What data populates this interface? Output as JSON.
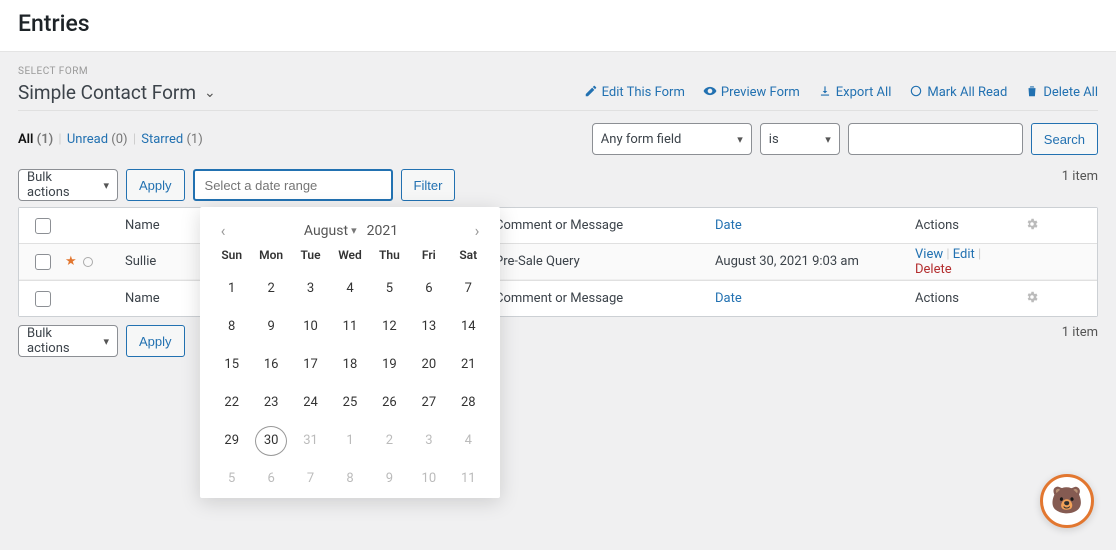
{
  "page": {
    "title": "Entries"
  },
  "select_form_label": "SELECT FORM",
  "form": {
    "name": "Simple Contact Form"
  },
  "form_actions": {
    "edit": "Edit This Form",
    "preview": "Preview Form",
    "export": "Export All",
    "mark_read": "Mark All Read",
    "delete_all": "Delete All"
  },
  "status_tabs": {
    "all_label": "All",
    "all_count": "(1)",
    "unread_label": "Unread",
    "unread_count": "(0)",
    "starred_label": "Starred",
    "starred_count": "(1)"
  },
  "search": {
    "field": "Any form field",
    "op": "is",
    "value": "",
    "button": "Search"
  },
  "bulk": {
    "label": "Bulk actions",
    "apply": "Apply",
    "date_placeholder": "Select a date range",
    "filter": "Filter"
  },
  "pagination": {
    "summary": "1 item"
  },
  "columns": {
    "name": "Name",
    "comment": "Comment or Message",
    "date": "Date",
    "actions": "Actions"
  },
  "entries": [
    {
      "starred": true,
      "name": "Sullie",
      "comment": "Pre-Sale Query",
      "date": "August 30, 2021 9:03 am",
      "view": "View",
      "edit": "Edit",
      "delete": "Delete"
    }
  ],
  "calendar": {
    "month": "August",
    "year": "2021",
    "dow": [
      "Sun",
      "Mon",
      "Tue",
      "Wed",
      "Thu",
      "Fri",
      "Sat"
    ],
    "weeks": [
      [
        "1",
        "2",
        "3",
        "4",
        "5",
        "6",
        "7"
      ],
      [
        "8",
        "9",
        "10",
        "11",
        "12",
        "13",
        "14"
      ],
      [
        "15",
        "16",
        "17",
        "18",
        "19",
        "20",
        "21"
      ],
      [
        "22",
        "23",
        "24",
        "25",
        "26",
        "27",
        "28"
      ],
      [
        "29",
        "30",
        "31",
        "1",
        "2",
        "3",
        "4"
      ],
      [
        "5",
        "6",
        "7",
        "8",
        "9",
        "10",
        "11"
      ]
    ],
    "today": "30",
    "muted_start": [
      5,
      3
    ],
    "muted_full_rows": [
      6
    ]
  }
}
